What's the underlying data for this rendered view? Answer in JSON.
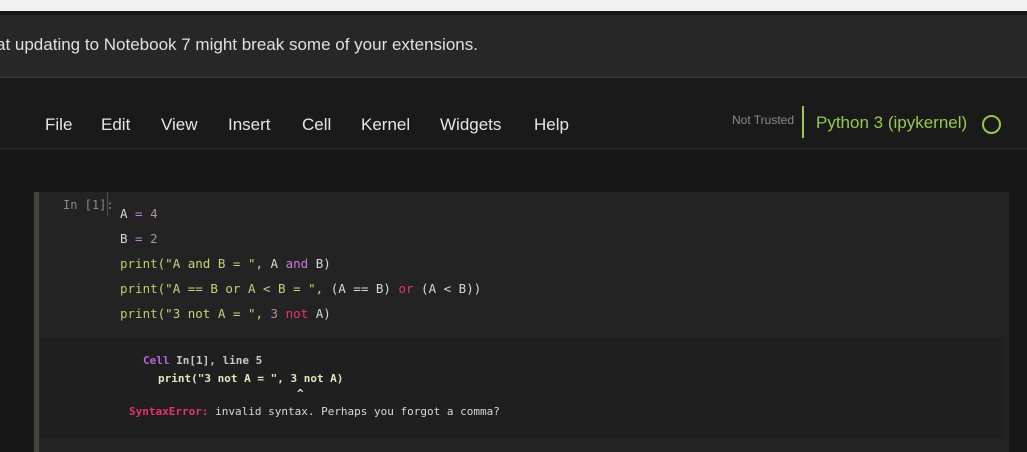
{
  "banner": {
    "text": "at updating to Notebook 7 might break some of your extensions."
  },
  "menu": {
    "items": [
      "File",
      "Edit",
      "View",
      "Insert",
      "Cell",
      "Kernel",
      "Widgets",
      "Help"
    ]
  },
  "status": {
    "trust": "Not Trusted",
    "kernel": "Python 3 (ipykernel)"
  },
  "cell": {
    "prompt": "In [1]:",
    "lines": [
      {
        "t1": "A",
        "t2": " = ",
        "t3": "4"
      },
      {
        "t1": "B",
        "t2": " = ",
        "t3": "2"
      },
      {
        "t1": "print",
        "t2": "(\"A and B = \", ",
        "t3": "A ",
        "t4": "and",
        "t5": " B)"
      },
      {
        "t1": "print",
        "t2": "(\"A == B or A < B = \", ",
        "t3": "(A == B) ",
        "t4": "or",
        "t5": " (A < B))"
      },
      {
        "t1": "print",
        "t2": "(\"3 not A = \", ",
        "t3": "3 ",
        "t4": "not",
        "t5": " A)"
      }
    ]
  },
  "output": {
    "cell_label": "Cell",
    "cell_ref": " In[1], line 5",
    "code": "print(\"3 not A = \", 3 not A)",
    "caret": "^",
    "error_name": "SyntaxError:",
    "error_msg": " invalid syntax. Perhaps you forgot a comma?"
  },
  "colors": {
    "kernel_accent": "#97c94a",
    "error": "#e8346b",
    "background": "#181818"
  }
}
